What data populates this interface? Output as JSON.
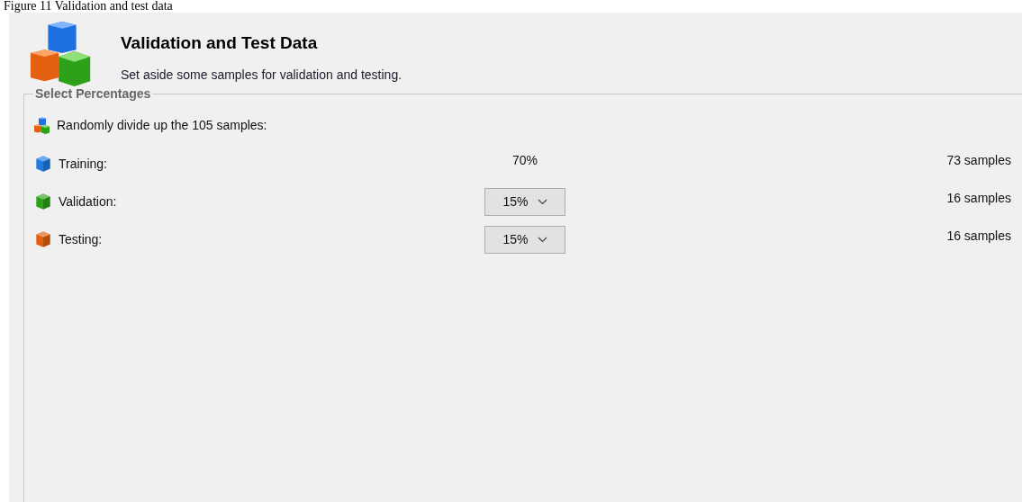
{
  "caption": "Figure 11 Validation and test data",
  "header": {
    "title": "Validation and Test Data",
    "subtitle": "Set aside some samples for validation and testing."
  },
  "group": {
    "legend": "Select Percentages",
    "intro": "Randomly divide up the 105 samples:",
    "rows": [
      {
        "label": "Training:",
        "kind": "fixed",
        "color": "#1e7be0",
        "percent": "70%",
        "samples": "73 samples"
      },
      {
        "label": "Validation:",
        "kind": "dropdown",
        "color": "#2ea11a",
        "percent": "15%",
        "samples": "16 samples"
      },
      {
        "label": "Testing:",
        "kind": "dropdown",
        "color": "#e2600f",
        "percent": "15%",
        "samples": "16 samples"
      }
    ]
  }
}
